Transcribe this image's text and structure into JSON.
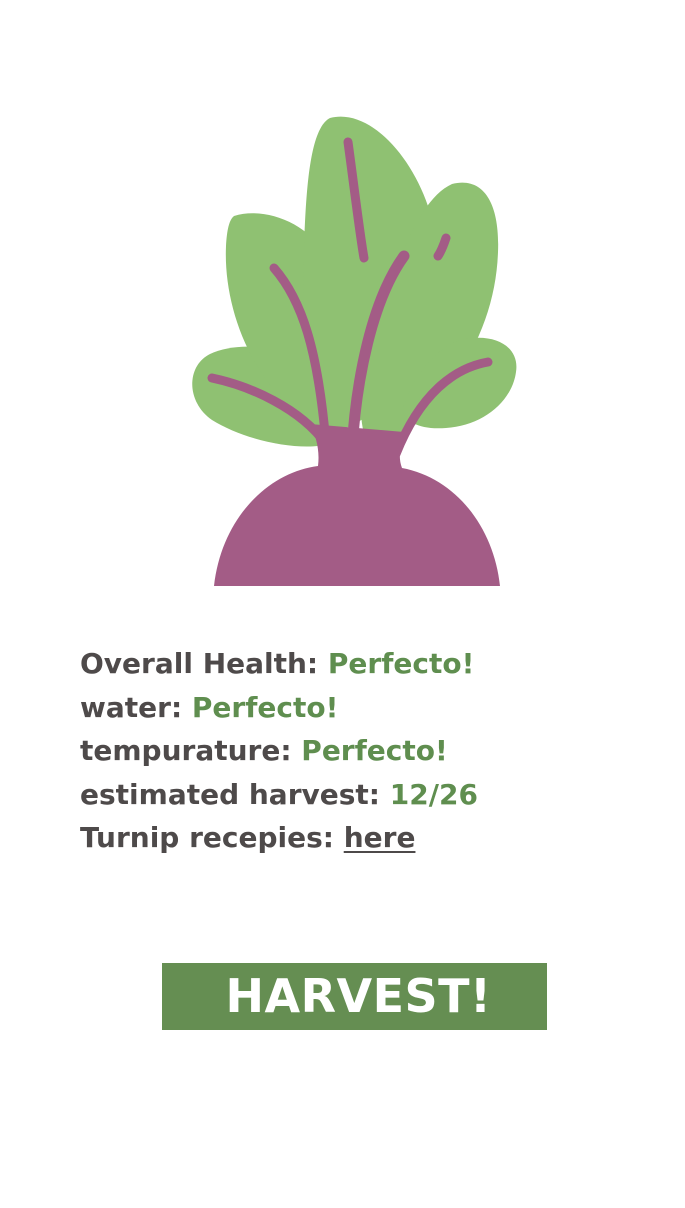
{
  "illustration": {
    "icon": "turnip-icon",
    "leaf_color": "#8fc172",
    "root_color": "#a35c86"
  },
  "stats": {
    "health": {
      "label": "Overall Health:",
      "value": "Perfecto!"
    },
    "water": {
      "label": "water:",
      "value": "Perfecto!"
    },
    "temperature": {
      "label": "tempurature:",
      "value": "Perfecto!"
    },
    "harvest_date": {
      "label": "estimated harvest:",
      "value": "12/26"
    },
    "recipes": {
      "label": "Turnip recepies:",
      "link": "here"
    }
  },
  "harvest_button": {
    "label": "HARVEST!",
    "color": "#658e52"
  },
  "colors": {
    "label_text": "#4e4a4a",
    "value_text": "#5f8e4f"
  }
}
